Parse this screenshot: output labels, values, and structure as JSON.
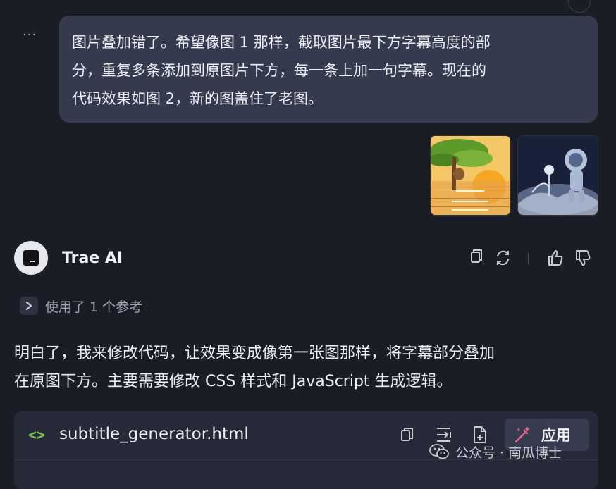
{
  "user_message": {
    "lines": [
      "图片叠加错了。希望像图 1 那样，截取图片最下方字幕高度的部",
      "分，重复多条添加到原图片下方，每一条上加一句字幕。现在的",
      "代码效果如图 2，新的图盖住了老图。"
    ]
  },
  "ai": {
    "name": "Trae AI",
    "reference_label": "使用了 1 个参考",
    "answer_lines": [
      "明白了，我来修改代码，让效果变成像第一张图那样，将字幕部分叠加",
      "在原图下方。主要需要修改 CSS 样式和 JavaScript 生成逻辑。"
    ]
  },
  "code_block": {
    "icon": "<>",
    "filename": "subtitle_generator.html",
    "apply_label": "应用"
  },
  "watermark": {
    "text": "公众号 · 南瓜博士"
  },
  "icons": {
    "more": "more-horizontal-icon",
    "copy": "copy-icon",
    "regenerate": "refresh-icon",
    "like": "thumbs-up-icon",
    "dislike": "thumbs-down-icon",
    "chevron": "chevron-right-icon",
    "insert": "insert-icon",
    "new_file": "new-file-icon",
    "apply": "magic-wand-icon"
  },
  "colors": {
    "background": "#1b1d26",
    "bubble": "#363a4e",
    "code_accent": "#7cc24a",
    "wand_accent": "#e5658b"
  }
}
